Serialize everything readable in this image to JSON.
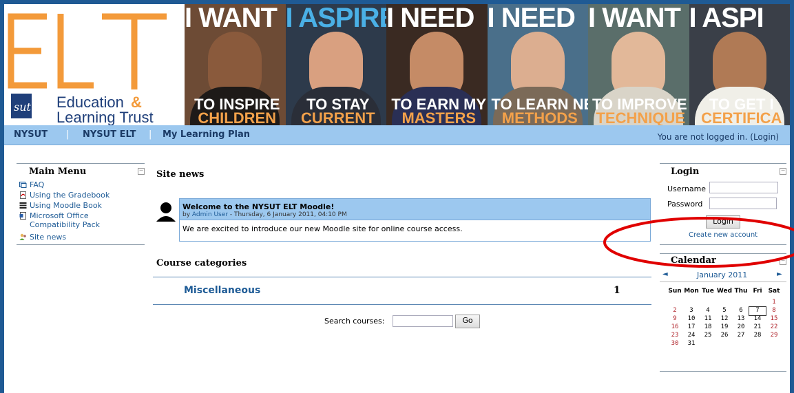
{
  "logo": {
    "text_line1": "Education",
    "ampersand": "&",
    "text_line2": "Learning Trust",
    "mark": "sut",
    "accent": "#f39a3a",
    "brand_blue": "#1f3f7a"
  },
  "banner": [
    {
      "headline": "I WANT",
      "sub1": "TO INSPIRE",
      "sub2": "CHILDREN",
      "bg": "#6d4b35",
      "skin": "#8a5a3c",
      "cloth": "#1e1a18",
      "headline_alt": false
    },
    {
      "headline": "I ASPIRE",
      "sub1": "TO STAY",
      "sub2": "CURRENT",
      "bg": "#2d3a4b",
      "skin": "#d9a080",
      "cloth": "#2a2e38",
      "headline_alt": true
    },
    {
      "headline": "I NEED",
      "sub1": "TO EARN MY",
      "sub2": "MASTERS",
      "bg": "#3a2a22",
      "skin": "#c58b66",
      "cloth": "#2a2f55",
      "headline_alt": false
    },
    {
      "headline": "I NEED",
      "sub1": "TO LEARN NEW",
      "sub2": "METHODS",
      "bg": "#4a6f8a",
      "skin": "#dcae90",
      "cloth": "#7b6a58",
      "headline_alt": false
    },
    {
      "headline": "I WANT",
      "sub1": "TO IMPROVE MY",
      "sub2": "TECHNIQUE",
      "bg": "#5a6e6a",
      "skin": "#e2b899",
      "cloth": "#d9d4c8",
      "headline_alt": false
    },
    {
      "headline": "I ASPI",
      "sub1": "TO GET I",
      "sub2": "CERTIFICA",
      "bg": "#3a3f48",
      "skin": "#b07a55",
      "cloth": "#f0efe8",
      "headline_alt": false
    }
  ],
  "nav": {
    "items": [
      "NYSUT",
      "NYSUT ELT",
      "My Learning Plan"
    ],
    "separator": "|",
    "status": "You are not logged in. (Login)"
  },
  "main_menu": {
    "title": "Main Menu",
    "items": [
      {
        "label": "FAQ",
        "icon": "faq-icon"
      },
      {
        "label": "Using the Gradebook",
        "icon": "pdf-icon"
      },
      {
        "label": "Using Moodle Book",
        "icon": "book-icon"
      },
      {
        "label": "Microsoft Office Compatibility Pack",
        "icon": "document-icon"
      },
      {
        "label": "Site news",
        "icon": "people-icon"
      }
    ]
  },
  "site_news": {
    "title": "Site news",
    "post": {
      "title": "Welcome to the NYSUT ELT Moodle!",
      "by_prefix": "by",
      "author": "Admin User",
      "date": " - Thursday, 6 January 2011, 04:10 PM",
      "body": "We are excited to introduce our new Moodle site for online course access."
    }
  },
  "course_categories": {
    "title": "Course categories",
    "category": "Miscellaneous",
    "count": "1"
  },
  "search": {
    "label": "Search courses:",
    "button": "Go",
    "value": ""
  },
  "login": {
    "title": "Login",
    "username_label": "Username",
    "password_label": "Password",
    "button": "Login",
    "create": "Create new account"
  },
  "calendar": {
    "title": "Calendar",
    "month": "January 2011",
    "prev": "◄",
    "next": "►",
    "days": [
      "Sun",
      "Mon",
      "Tue",
      "Wed",
      "Thu",
      "Fri",
      "Sat"
    ],
    "weeks": [
      [
        "",
        "",
        "",
        "",
        "",
        "",
        "1"
      ],
      [
        "2",
        "3",
        "4",
        "5",
        "6",
        "7",
        "8"
      ],
      [
        "9",
        "10",
        "11",
        "12",
        "13",
        "14",
        "15"
      ],
      [
        "16",
        "17",
        "18",
        "19",
        "20",
        "21",
        "22"
      ],
      [
        "23",
        "24",
        "25",
        "26",
        "27",
        "28",
        "29"
      ],
      [
        "30",
        "31",
        "",
        "",
        "",
        "",
        ""
      ]
    ],
    "today": "7"
  },
  "annotation": {
    "color": "#e00000"
  }
}
